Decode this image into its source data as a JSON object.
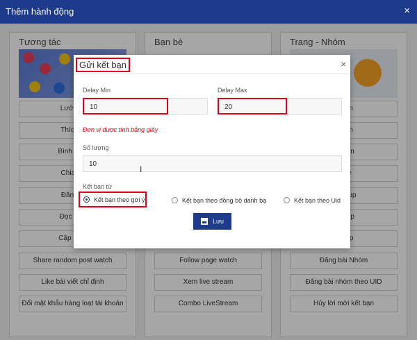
{
  "window": {
    "title": "Thêm hành động",
    "close_glyph": "×"
  },
  "columns": [
    {
      "title": "Tương tác",
      "buttons": [
        "Lướt ne",
        "Thích B",
        "Bình luận",
        "Chia sẻ",
        "Đăng B",
        "Đọc Thô",
        "Cập nhật",
        "Share random post watch",
        "Like bài viết chỉ định",
        "Đổi mật khẩu hàng loạt tài khoản"
      ]
    },
    {
      "title": "Bạn bè",
      "buttons": [
        "",
        "",
        "",
        "",
        "",
        "",
        "",
        "Follow page watch",
        "Xem live stream",
        "Combo LiveStream"
      ]
    },
    {
      "title": "Trang - Nhóm",
      "buttons": [
        "Nhóm",
        "Nhóm",
        "stream",
        "page",
        "d Group",
        "t group",
        "Group",
        "Đăng bài Nhóm",
        "Đăng bài nhóm theo UID",
        "Hủy lời mời kết bạn"
      ]
    }
  ],
  "dialog": {
    "title": "Gửi kết bạn",
    "close_glyph": "×",
    "delay_min_label": "Delay Min",
    "delay_min_value": "10",
    "delay_max_label": "Delay Max",
    "delay_max_value": "20",
    "note": "Đơn vị được tính bằng giây",
    "quantity_label": "Số lượng",
    "quantity_value": "10",
    "source_label": "Kết bạn từ",
    "options": [
      {
        "label": "Kết bạn theo gợi ý",
        "checked": true
      },
      {
        "label": "Kết bạn theo đồng bộ danh bạ",
        "checked": false
      },
      {
        "label": "Kết bạn theo Uid",
        "checked": false
      }
    ],
    "save_label": "Lưu"
  },
  "colors": {
    "header": "#1e3a8a",
    "highlight": "#e3001b",
    "note": "#e3001b"
  }
}
